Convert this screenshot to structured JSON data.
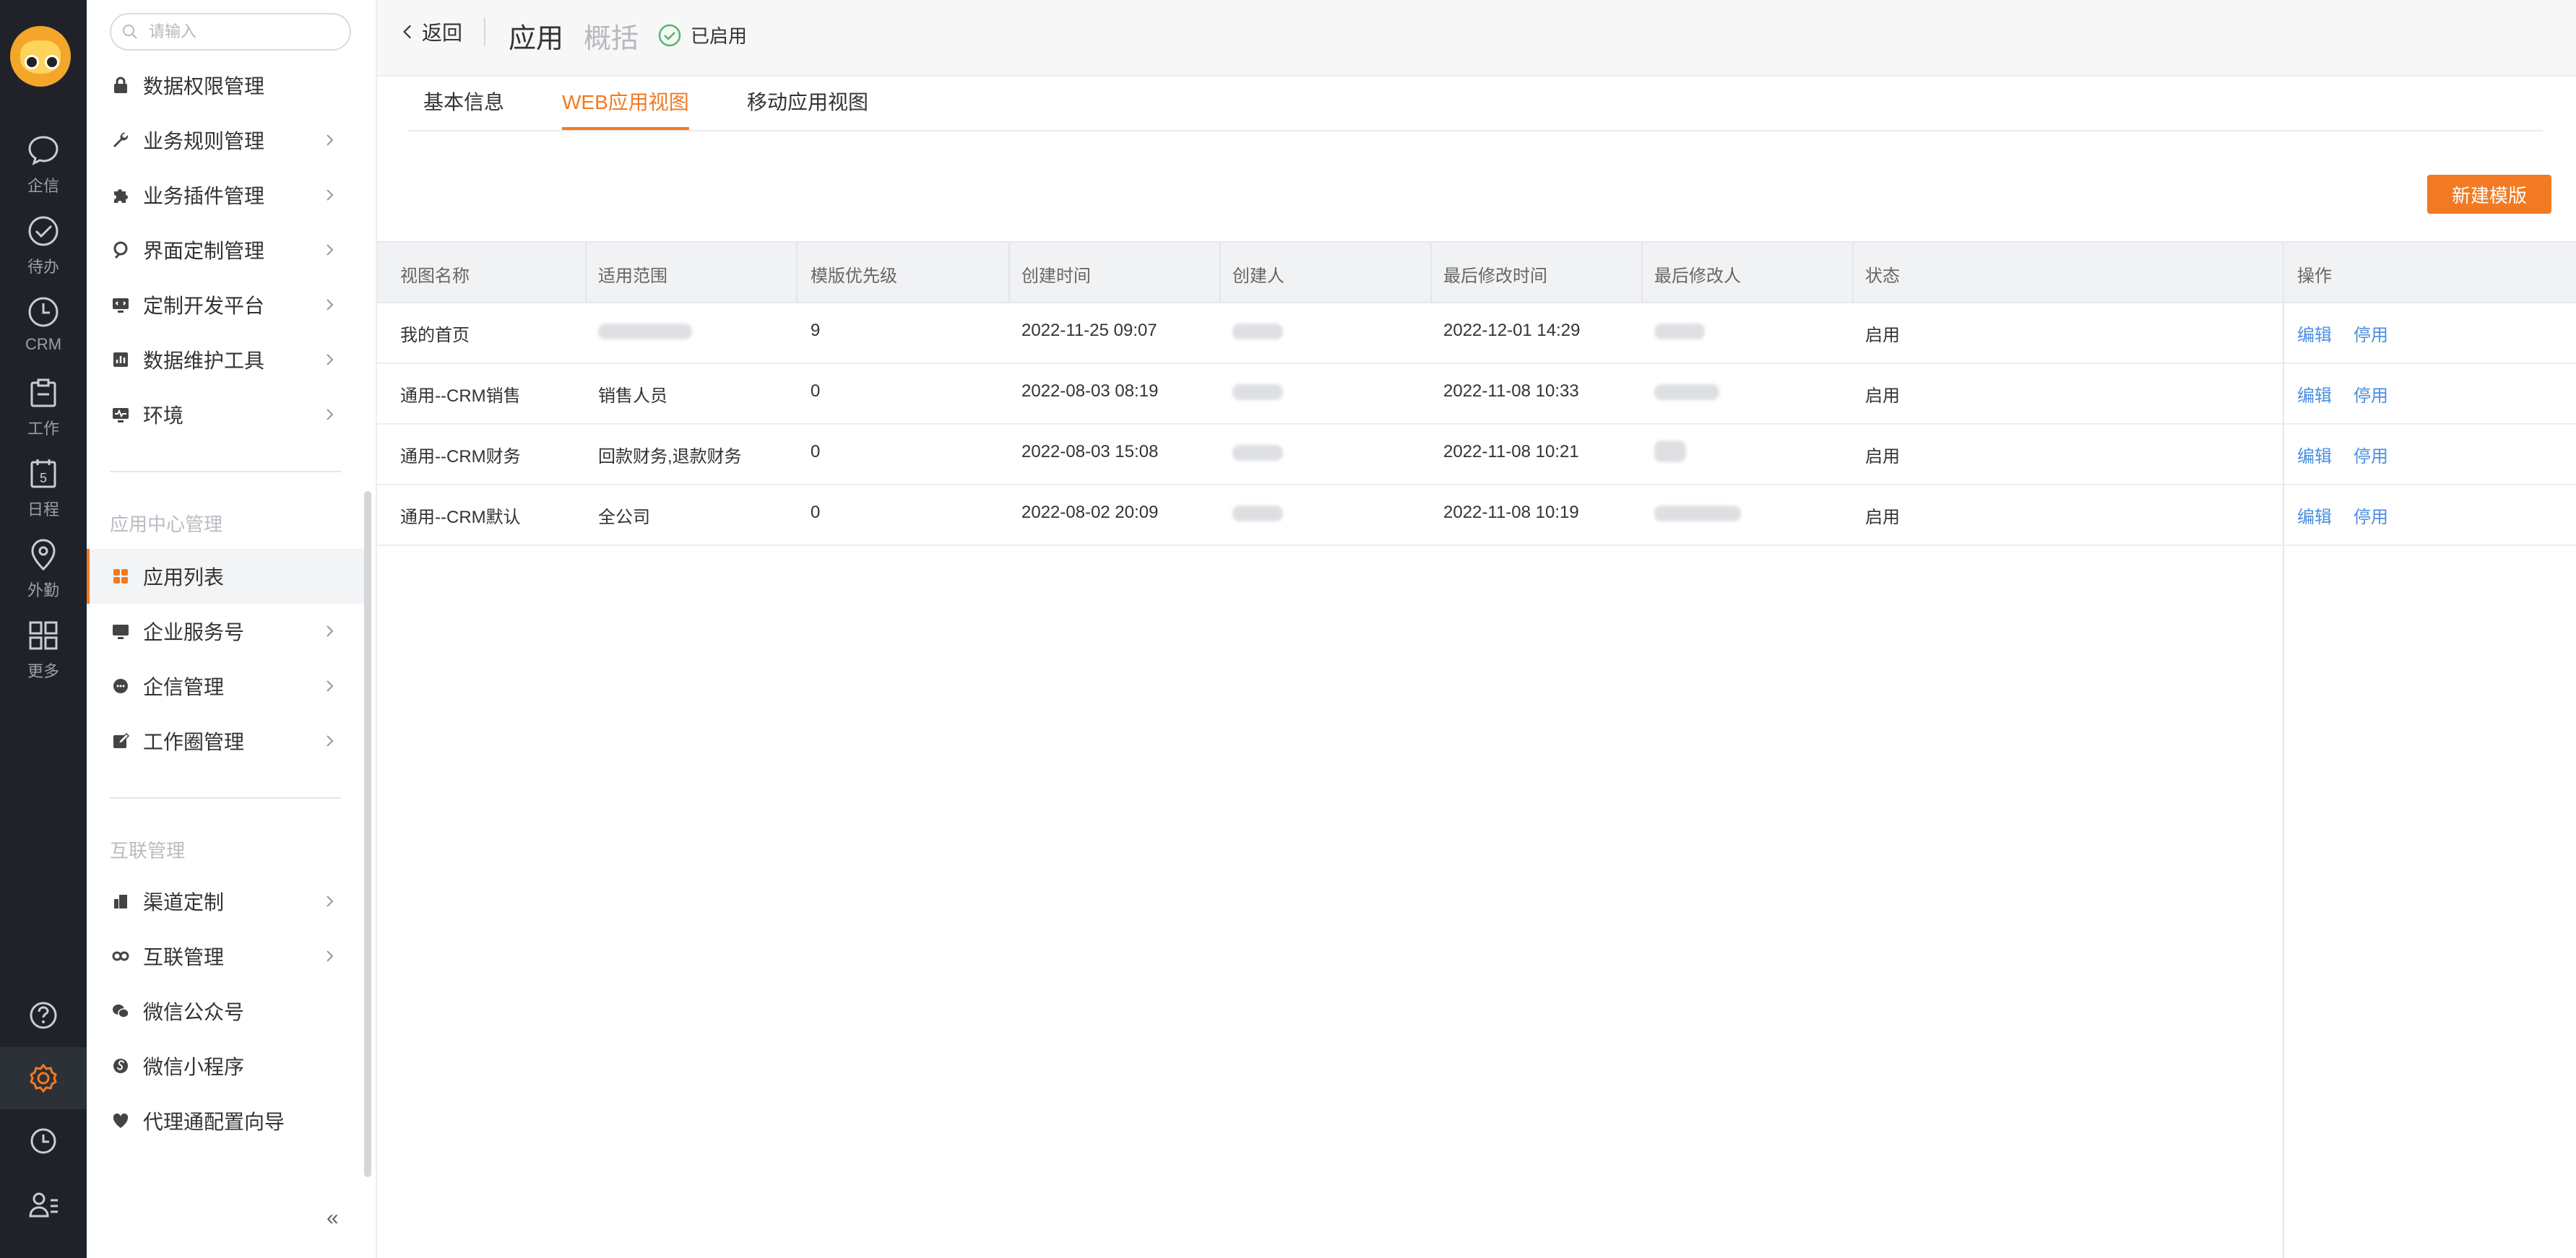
{
  "rail": {
    "items": [
      {
        "name": "chat",
        "label": "企信",
        "icon": "chat-bubble-icon"
      },
      {
        "name": "todo",
        "label": "待办",
        "icon": "check-circle-icon"
      },
      {
        "name": "crm",
        "label": "CRM",
        "icon": "clock-icon"
      },
      {
        "name": "work",
        "label": "工作",
        "icon": "clipboard-icon"
      },
      {
        "name": "schedule",
        "label": "日程",
        "icon": "calendar-icon",
        "badge": "5"
      },
      {
        "name": "field",
        "label": "外勤",
        "icon": "location-pin-icon"
      },
      {
        "name": "more",
        "label": "更多",
        "icon": "grid-icon"
      }
    ],
    "bottom_icons": [
      "help-icon",
      "settings-icon",
      "history-icon",
      "user-list-icon"
    ],
    "accent": "#f27a22"
  },
  "sidebar": {
    "search_placeholder": "请输入",
    "groups_top": [
      {
        "label": "数据权限管理",
        "icon": "lock-icon",
        "chevron": false
      },
      {
        "label": "业务规则管理",
        "icon": "wrench-icon",
        "chevron": true
      },
      {
        "label": "业务插件管理",
        "icon": "puzzle-icon",
        "chevron": true
      },
      {
        "label": "界面定制管理",
        "icon": "brush-icon",
        "chevron": true
      },
      {
        "label": "定制开发平台",
        "icon": "monitor-code-icon",
        "chevron": true
      },
      {
        "label": "数据维护工具",
        "icon": "bar-chart-icon",
        "chevron": true
      },
      {
        "label": "环境",
        "icon": "monitor-pulse-icon",
        "chevron": true
      }
    ],
    "section_app_center": "应用中心管理",
    "groups_app": [
      {
        "label": "应用列表",
        "icon": "apps-icon",
        "chevron": false,
        "active": true
      },
      {
        "label": "企业服务号",
        "icon": "monitor-icon",
        "chevron": true
      },
      {
        "label": "企信管理",
        "icon": "chat-icon",
        "chevron": true
      },
      {
        "label": "工作圈管理",
        "icon": "edit-square-icon",
        "chevron": true
      }
    ],
    "section_interconnect": "互联管理",
    "groups_interconnect": [
      {
        "label": "渠道定制",
        "icon": "building-icon",
        "chevron": true
      },
      {
        "label": "互联管理",
        "icon": "link-icon",
        "chevron": true
      },
      {
        "label": "微信公众号",
        "icon": "wechat-icon",
        "chevron": false
      },
      {
        "label": "微信小程序",
        "icon": "mini-program-icon",
        "chevron": false
      },
      {
        "label": "代理通配置向导",
        "icon": "heart-shield-icon",
        "chevron": false
      }
    ],
    "collapse_glyph": "«"
  },
  "header": {
    "back_label": "返回",
    "title": "应用",
    "subtitle": "概括",
    "status": "已启用",
    "status_color": "#52b76a"
  },
  "tabs": [
    {
      "label": "基本信息",
      "active": false
    },
    {
      "label": "WEB应用视图",
      "active": true
    },
    {
      "label": "移动应用视图",
      "active": false
    }
  ],
  "new_button_label": "新建模版",
  "table": {
    "columns": [
      "视图名称",
      "适用范围",
      "模版优先级",
      "创建时间",
      "创建人",
      "最后修改时间",
      "最后修改人",
      "状态",
      "操作"
    ],
    "rows": [
      {
        "name": "我的首页",
        "scope": "",
        "priority": "9",
        "created": "2022-11-25 09:07",
        "creator": "",
        "modified": "2022-12-01 14:29",
        "modifier": "",
        "status": "启用",
        "ops": [
          "编辑",
          "停用"
        ]
      },
      {
        "name": "通用--CRM销售",
        "scope": "销售人员",
        "priority": "0",
        "created": "2022-08-03 08:19",
        "creator": "",
        "modified": "2022-11-08 10:33",
        "modifier": "",
        "status": "启用",
        "ops": [
          "编辑",
          "停用"
        ]
      },
      {
        "name": "通用--CRM财务",
        "scope": "回款财务,退款财务",
        "priority": "0",
        "created": "2022-08-03 15:08",
        "creator": "",
        "modified": "2022-11-08 10:21",
        "modifier": "",
        "status": "启用",
        "ops": [
          "编辑",
          "停用"
        ]
      },
      {
        "name": "通用--CRM默认",
        "scope": "全公司",
        "priority": "0",
        "created": "2022-08-02 20:09",
        "creator": "",
        "modified": "2022-11-08 10:19",
        "modifier": "",
        "status": "启用",
        "ops": [
          "编辑",
          "停用"
        ]
      }
    ],
    "link_color": "#4b8fe0"
  }
}
